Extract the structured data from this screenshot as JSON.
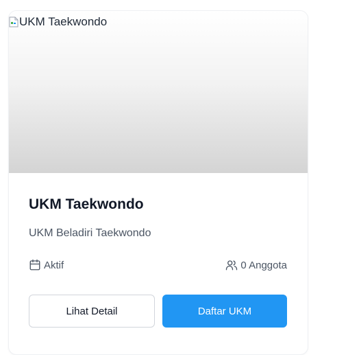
{
  "card": {
    "image_alt": "UKM Taekwondo",
    "title": "UKM Taekwondo",
    "description": "UKM Beladiri Taekwondo",
    "status_label": "Aktif",
    "members_label": "0 Anggota",
    "detail_button_label": "Lihat Detail",
    "register_button_label": "Daftar UKM"
  },
  "icons": {
    "broken_image": "broken-image-icon",
    "status": "calendar-icon",
    "members": "users-icon"
  },
  "colors": {
    "primary": "#2196f3",
    "title_text": "#111827",
    "muted_text": "#4b5563"
  }
}
